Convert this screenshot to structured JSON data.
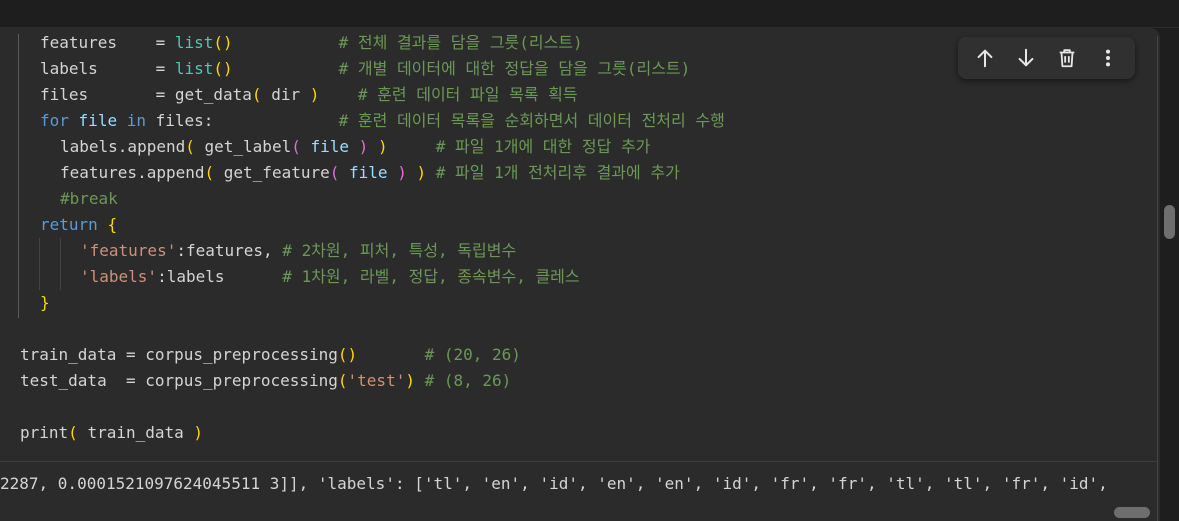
{
  "editor": {
    "lines": [
      {
        "indent": 1,
        "tokens": [
          [
            "plain",
            "features    = "
          ],
          [
            "bi",
            "list"
          ],
          [
            "p1",
            "()"
          ],
          [
            "plain",
            "           "
          ],
          [
            "cm",
            "# 전체 결과를 담을 그릇(리스트)"
          ]
        ]
      },
      {
        "indent": 1,
        "tokens": [
          [
            "plain",
            "labels      = "
          ],
          [
            "bi",
            "list"
          ],
          [
            "p1",
            "()"
          ],
          [
            "plain",
            "           "
          ],
          [
            "cm",
            "# 개별 데이터에 대한 정답을 담을 그릇(리스트)"
          ]
        ]
      },
      {
        "indent": 1,
        "tokens": [
          [
            "plain",
            "files       = get_data"
          ],
          [
            "p1",
            "("
          ],
          [
            "plain",
            " dir "
          ],
          [
            "p1",
            ")"
          ],
          [
            "plain",
            "    "
          ],
          [
            "cm",
            "# 훈련 데이터 파일 목록 획득"
          ]
        ]
      },
      {
        "indent": 1,
        "tokens": [
          [
            "kw",
            "for"
          ],
          [
            "plain",
            " "
          ],
          [
            "var",
            "file"
          ],
          [
            "plain",
            " "
          ],
          [
            "kw",
            "in"
          ],
          [
            "plain",
            " files:             "
          ],
          [
            "cm",
            "# 훈련 데이터 목록을 순회하면서 데이터 전처리 수행"
          ]
        ]
      },
      {
        "indent": 2,
        "tokens": [
          [
            "plain",
            "labels.append"
          ],
          [
            "p1",
            "("
          ],
          [
            "plain",
            " get_label"
          ],
          [
            "p2",
            "("
          ],
          [
            "plain",
            " "
          ],
          [
            "var",
            "file"
          ],
          [
            "plain",
            " "
          ],
          [
            "p2",
            ")"
          ],
          [
            "plain",
            " "
          ],
          [
            "p1",
            ")"
          ],
          [
            "plain",
            "     "
          ],
          [
            "cm",
            "# 파일 1개에 대한 정답 추가"
          ]
        ]
      },
      {
        "indent": 2,
        "tokens": [
          [
            "plain",
            "features.append"
          ],
          [
            "p1",
            "("
          ],
          [
            "plain",
            " get_feature"
          ],
          [
            "p2",
            "("
          ],
          [
            "plain",
            " "
          ],
          [
            "var",
            "file"
          ],
          [
            "plain",
            " "
          ],
          [
            "p2",
            ")"
          ],
          [
            "plain",
            " "
          ],
          [
            "p1",
            ")"
          ],
          [
            "plain",
            " "
          ],
          [
            "cm",
            "# 파일 1개 전처리후 결과에 추가"
          ]
        ]
      },
      {
        "indent": 2,
        "tokens": [
          [
            "cm",
            "#break"
          ]
        ]
      },
      {
        "indent": 1,
        "tokens": [
          [
            "kw",
            "return"
          ],
          [
            "plain",
            " "
          ],
          [
            "p1",
            "{"
          ]
        ]
      },
      {
        "indent": 3,
        "tokens": [
          [
            "str",
            "'features'"
          ],
          [
            "plain",
            ":features, "
          ],
          [
            "cm",
            "# 2차원, 피처, 특성, 독립변수"
          ]
        ]
      },
      {
        "indent": 3,
        "tokens": [
          [
            "str",
            "'labels'"
          ],
          [
            "plain",
            ":labels      "
          ],
          [
            "cm",
            "# 1차원, 라벨, 정답, 종속변수, 클레스"
          ]
        ]
      },
      {
        "indent": 1,
        "tokens": [
          [
            "p1",
            "}"
          ]
        ]
      },
      {
        "indent": 0,
        "tokens": []
      },
      {
        "indent": 0,
        "tokens": [
          [
            "plain",
            "train_data = corpus_preprocessing"
          ],
          [
            "p1",
            "()"
          ],
          [
            "plain",
            "       "
          ],
          [
            "cm",
            "# (20, 26)"
          ]
        ]
      },
      {
        "indent": 0,
        "tokens": [
          [
            "plain",
            "test_data  = corpus_preprocessing"
          ],
          [
            "p1",
            "("
          ],
          [
            "str",
            "'test'"
          ],
          [
            "p1",
            ")"
          ],
          [
            "plain",
            " "
          ],
          [
            "cm",
            "# (8, 26)"
          ]
        ]
      },
      {
        "indent": 0,
        "tokens": []
      },
      {
        "indent": 0,
        "tokens": [
          [
            "plain",
            "print"
          ],
          [
            "p1",
            "("
          ],
          [
            "plain",
            " train_data "
          ],
          [
            "p1",
            ")"
          ]
        ]
      }
    ]
  },
  "toolbar": {
    "move_up_label": "Move cell up",
    "move_down_label": "Move cell down",
    "delete_label": "Delete cell",
    "more_label": "More actions"
  },
  "output": {
    "text": "2287, 0.0001521097624045511 3]], 'labels': ['tl', 'en', 'id', 'en', 'en', 'id', 'fr', 'fr', 'tl', 'tl', 'fr', 'id',"
  },
  "colors": {
    "background": "#2b2b2b",
    "keyword": "#569cd6",
    "builtin": "#4ec9b0",
    "string": "#ce9178",
    "comment": "#6a9955",
    "bracket1": "#ffd700",
    "bracket2": "#da70d6"
  }
}
